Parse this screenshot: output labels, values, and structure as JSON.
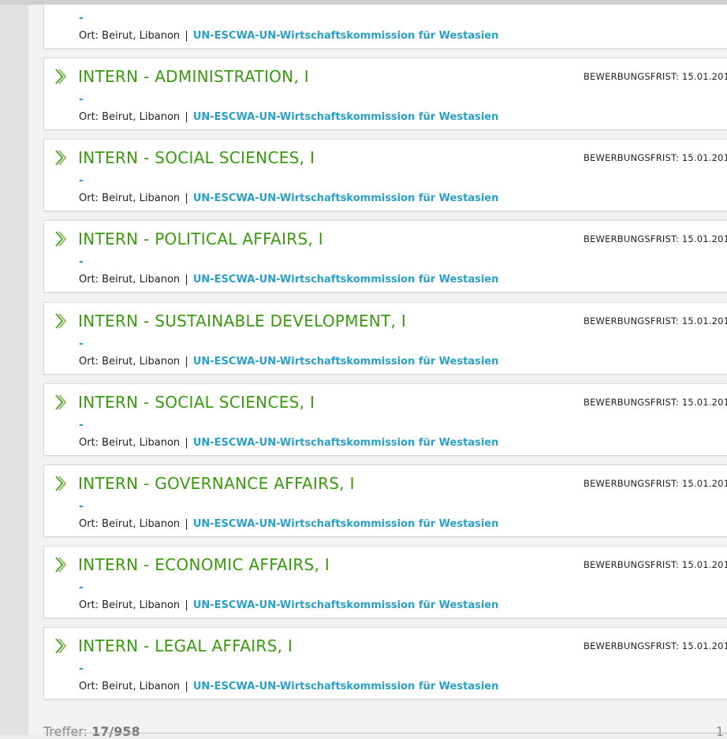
{
  "partial_item": {
    "dash": "-",
    "location": "Ort: Beirut, Libanon",
    "separator": "|",
    "organization": "UN-ESCWA-UN-Wirtschaftskommission für Westasien"
  },
  "listings": [
    {
      "title": "INTERN - ADMINISTRATION, I",
      "deadline": "BEWERBUNGSFRIST: 15.01.201",
      "dash": "-",
      "location": "Ort: Beirut, Libanon",
      "separator": "|",
      "organization": "UN-ESCWA-UN-Wirtschaftskommission für Westasien"
    },
    {
      "title": "INTERN - SOCIAL SCIENCES, I",
      "deadline": "BEWERBUNGSFRIST: 15.01.201",
      "dash": "-",
      "location": "Ort: Beirut, Libanon",
      "separator": "|",
      "organization": "UN-ESCWA-UN-Wirtschaftskommission für Westasien"
    },
    {
      "title": "INTERN - POLITICAL AFFAIRS, I",
      "deadline": "BEWERBUNGSFRIST: 15.01.201",
      "dash": "-",
      "location": "Ort: Beirut, Libanon",
      "separator": "|",
      "organization": "UN-ESCWA-UN-Wirtschaftskommission für Westasien"
    },
    {
      "title": "INTERN - SUSTAINABLE DEVELOPMENT, I",
      "deadline": "BEWERBUNGSFRIST: 15.01.201",
      "dash": "-",
      "location": "Ort: Beirut, Libanon",
      "separator": "|",
      "organization": "UN-ESCWA-UN-Wirtschaftskommission für Westasien"
    },
    {
      "title": "INTERN - SOCIAL SCIENCES, I",
      "deadline": "BEWERBUNGSFRIST: 15.01.201",
      "dash": "-",
      "location": "Ort: Beirut, Libanon",
      "separator": "|",
      "organization": "UN-ESCWA-UN-Wirtschaftskommission für Westasien"
    },
    {
      "title": "INTERN - GOVERNANCE AFFAIRS, I",
      "deadline": "BEWERBUNGSFRIST: 15.01.201",
      "dash": "-",
      "location": "Ort: Beirut, Libanon",
      "separator": "|",
      "organization": "UN-ESCWA-UN-Wirtschaftskommission für Westasien"
    },
    {
      "title": "INTERN - ECONOMIC AFFAIRS, I",
      "deadline": "BEWERBUNGSFRIST: 15.01.201",
      "dash": "-",
      "location": "Ort: Beirut, Libanon",
      "separator": "|",
      "organization": "UN-ESCWA-UN-Wirtschaftskommission für Westasien"
    },
    {
      "title": "INTERN - LEGAL AFFAIRS, I",
      "deadline": "BEWERBUNGSFRIST: 15.01.201",
      "dash": "-",
      "location": "Ort: Beirut, Libanon",
      "separator": "|",
      "organization": "UN-ESCWA-UN-Wirtschaftskommission für Westasien"
    }
  ],
  "footer": {
    "hits_label": "Treffer:",
    "hits_value": "17/958",
    "page_right": "1"
  },
  "colors": {
    "title_green": "#3a9a0f",
    "link_blue": "#2aa0c8"
  },
  "icons": {
    "listing_marker": "chevron-right-icon"
  }
}
